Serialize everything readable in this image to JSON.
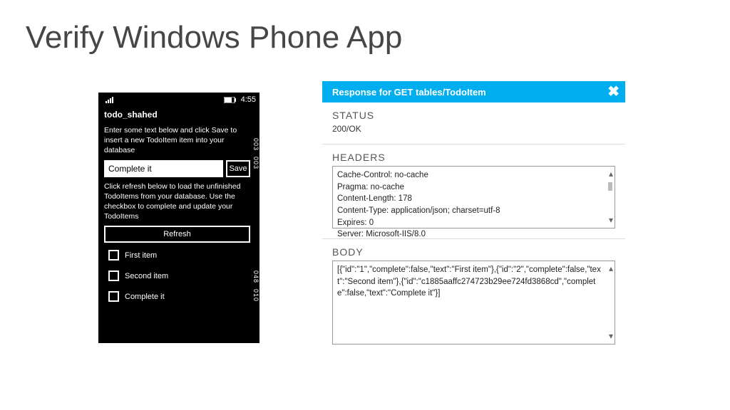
{
  "slide": {
    "title": "Verify Windows Phone App"
  },
  "phone": {
    "time": "4:55",
    "app_title": "todo_shahed",
    "instruction_insert": "Enter some text below and click Save to insert a new TodoItem item into your database",
    "input_value": "Complete it",
    "save_label": "Save",
    "instruction_refresh": "Click refresh below to load the unfinished TodoItems from your database. Use the checkbox to complete and update your TodoItems",
    "refresh_label": "Refresh",
    "items": [
      "First item",
      "Second item",
      "Complete it"
    ],
    "mem_codes": [
      "003",
      "003",
      "048",
      "010"
    ]
  },
  "response": {
    "header": "Response for GET tables/TodoItem",
    "status_heading": "STATUS",
    "status_value": "200/OK",
    "headers_heading": "HEADERS",
    "headers_lines": [
      "Cache-Control: no-cache",
      "Pragma: no-cache",
      "Content-Length: 178",
      "Content-Type: application/json; charset=utf-8",
      "Expires: 0",
      "Server: Microsoft-IIS/8.0"
    ],
    "body_heading": "BODY",
    "body_text": "[{\"id\":\"1\",\"complete\":false,\"text\":\"First item\"},{\"id\":\"2\",\"complete\":false,\"text\":\"Second item\"},{\"id\":\"c1885aaffc274723b29ee724fd3868cd\",\"complete\":false,\"text\":\"Complete it\"}]"
  }
}
